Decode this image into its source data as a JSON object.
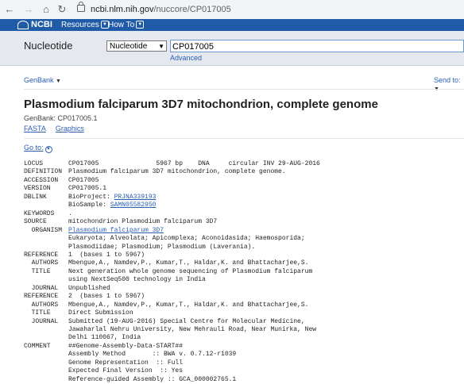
{
  "browser": {
    "url_host": "ncbi.nlm.nih.gov",
    "url_path": "/nuccore/CP017005"
  },
  "ncbi_bar": {
    "logo": "NCBI",
    "resources": "Resources",
    "howto": "How To"
  },
  "search": {
    "db_title": "Nucleotide",
    "db_selected": "Nucleotide",
    "query": "CP017005",
    "advanced": "Advanced"
  },
  "toolbar": {
    "format": "GenBank",
    "send_to": "Send to:"
  },
  "record": {
    "title": "Plasmodium falciparum 3D7 mitochondrion, complete genome",
    "accession_line": "GenBank: CP017005.1",
    "link_fasta": "FASTA",
    "link_graphics": "Graphics",
    "goto": "Go to:"
  },
  "genbank": [
    {
      "key": "LOCUS",
      "val": "CP017005               5967 bp    DNA     circular INV 29-AUG-2016",
      "link": false
    },
    {
      "key": "DEFINITION",
      "val": "Plasmodium falciparum 3D7 mitochondrion, complete genome.",
      "link": false
    },
    {
      "key": "ACCESSION",
      "val": "CP017005",
      "link": false
    },
    {
      "key": "VERSION",
      "val": "CP017005.1",
      "link": false
    },
    {
      "key": "DBLINK",
      "val": "BioProject: PRJNA339193",
      "link": false
    },
    {
      "key": "",
      "val": "BioSample: SAMN05582950",
      "link": false
    },
    {
      "key": "KEYWORDS",
      "val": ".",
      "link": false
    },
    {
      "key": "SOURCE",
      "val": "mitochondrion Plasmodium falciparum 3D7",
      "link": false
    },
    {
      "key": "  ORGANISM",
      "val": "Plasmodium falciparum 3D7",
      "link": true
    },
    {
      "key": "",
      "val": "Eukaryota; Alveolata; Apicomplexa; Aconoidasida; Haemosporida;",
      "link": false
    },
    {
      "key": "",
      "val": "Plasmodiidae; Plasmodium; Plasmodium (Laverania).",
      "link": false
    },
    {
      "key": "REFERENCE",
      "val": "1  (bases 1 to 5967)",
      "link": false
    },
    {
      "key": "  AUTHORS",
      "val": "Mbengue,A., Namdev,P., Kumar,T., Haldar,K. and Bhattacharjee,S.",
      "link": false
    },
    {
      "key": "  TITLE",
      "val": "Next generation whole genome sequencing of Plasmodium falciparum",
      "link": false
    },
    {
      "key": "",
      "val": "using NextSeq500 technology in India",
      "link": false
    },
    {
      "key": "  JOURNAL",
      "val": "Unpublished",
      "link": false
    },
    {
      "key": "REFERENCE",
      "val": "2  (bases 1 to 5967)",
      "link": false
    },
    {
      "key": "  AUTHORS",
      "val": "Mbengue,A., Namdev,P., Kumar,T., Haldar,K. and Bhattacharjee,S.",
      "link": false
    },
    {
      "key": "  TITLE",
      "val": "Direct Submission",
      "link": false
    },
    {
      "key": "  JOURNAL",
      "val": "Submitted (19-AUG-2016) Special Centre for Molecular Medicine,",
      "link": false
    },
    {
      "key": "",
      "val": "Jawaharlal Nehru University, New Mehrauli Road, Near Munirka, New",
      "link": false
    },
    {
      "key": "",
      "val": "Delhi 110067, India",
      "link": false
    },
    {
      "key": "COMMENT",
      "val": "##Genome-Assembly-Data-START##",
      "link": false
    },
    {
      "key": "",
      "val": "Assembly Method       :: BWA v. 0.7.12-r1039",
      "link": false
    },
    {
      "key": "",
      "val": "Genome Representation  :: Full",
      "link": false
    },
    {
      "key": "",
      "val": "Expected Final Version  :: Yes",
      "link": false
    },
    {
      "key": "",
      "val": "Reference-guided Assembly :: GCA_000002765.1",
      "link": false
    }
  ]
}
